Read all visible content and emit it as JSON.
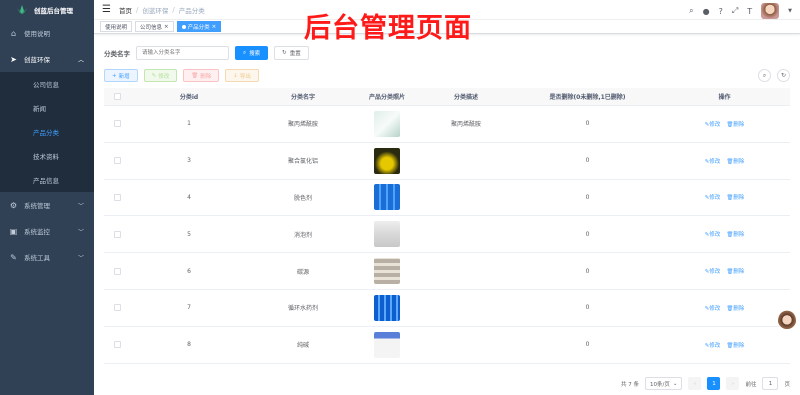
{
  "app": {
    "title": "创蓝后台管理"
  },
  "sidebar": {
    "items": [
      {
        "label": "使用说明",
        "icon": "home-icon"
      },
      {
        "label": "创蓝环保",
        "icon": "send-icon",
        "open": true,
        "children": [
          {
            "label": "公司信息"
          },
          {
            "label": "新闻"
          },
          {
            "label": "产品分类",
            "active": true
          },
          {
            "label": "技术资料"
          },
          {
            "label": "产品信息"
          }
        ]
      },
      {
        "label": "系统管理",
        "icon": "gear-icon"
      },
      {
        "label": "系统监控",
        "icon": "monitor-icon"
      },
      {
        "label": "系统工具",
        "icon": "tool-icon"
      }
    ]
  },
  "breadcrumb": [
    "首页",
    "创蓝环保",
    "产品分类"
  ],
  "tags": [
    {
      "label": "使用说明"
    },
    {
      "label": "公司信息"
    },
    {
      "label": "产品分类",
      "active": true
    }
  ],
  "overlay_title": "后台管理页面",
  "search": {
    "label": "分类名字",
    "placeholder": "请输入分类名字",
    "search_btn": "搜索",
    "reset_btn": "重置"
  },
  "toolbar": {
    "add": "新增",
    "edit": "修改",
    "delete": "删除",
    "export": "导出"
  },
  "table": {
    "headers": [
      "分类id",
      "分类名字",
      "产品分类照片",
      "分类描述",
      "是否删除(0未删除,1已删除)",
      "操作"
    ],
    "rows": [
      {
        "id": "1",
        "name": "聚丙烯酰胺",
        "desc": "聚丙烯酰胺",
        "deleted": "0",
        "img": "white-powder"
      },
      {
        "id": "3",
        "name": "聚合氯化铝",
        "desc": "",
        "deleted": "0",
        "img": "yellow-powder"
      },
      {
        "id": "4",
        "name": "脱色剂",
        "desc": "",
        "deleted": "0",
        "img": "blue-drums"
      },
      {
        "id": "5",
        "name": "消泡剂",
        "desc": "",
        "deleted": "0",
        "img": "white-container"
      },
      {
        "id": "6",
        "name": "碳源",
        "desc": "",
        "deleted": "0",
        "img": "bags"
      },
      {
        "id": "7",
        "name": "循环水药剂",
        "desc": "",
        "deleted": "0",
        "img": "blue-barrels"
      },
      {
        "id": "8",
        "name": "纯碱",
        "desc": "",
        "deleted": "0",
        "img": "soda-bag"
      }
    ],
    "op_edit": "修改",
    "op_delete": "删除"
  },
  "pagination": {
    "total": "共 7 条",
    "page_size": "10条/页",
    "current": "1",
    "goto_label": "前往",
    "goto_value": "1",
    "goto_suffix": "页"
  }
}
